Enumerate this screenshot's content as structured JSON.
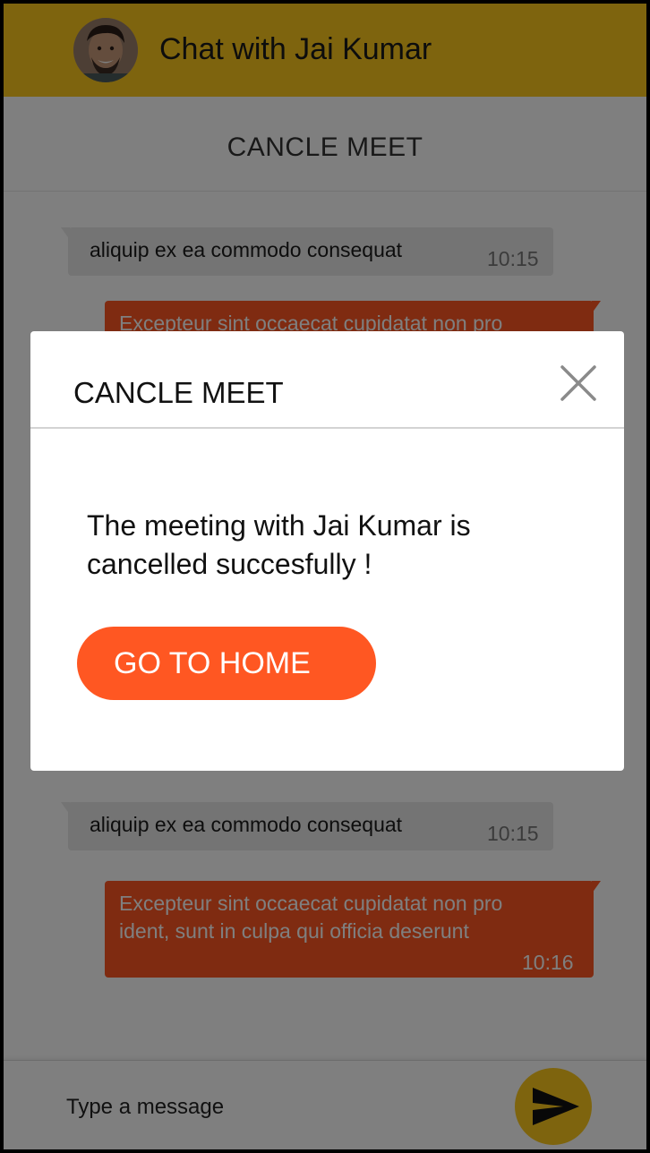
{
  "header": {
    "title": "Chat with Jai Kumar",
    "accent_color": "#FDC81C"
  },
  "subbar": {
    "title": "CANCLE MEET"
  },
  "messages": [
    {
      "direction": "in",
      "text": "aliquip ex ea commodo consequat",
      "time": "10:15"
    },
    {
      "direction": "out",
      "text": "Excepteur sint occaecat cupidatat non pro",
      "time": ""
    },
    {
      "direction": "in",
      "text": "aliquip ex ea commodo consequat",
      "time": "10:15"
    },
    {
      "direction": "out",
      "text": "Excepteur sint occaecat cupidatat non pro\nident, sunt in culpa qui officia deserunt",
      "time": "10:16"
    }
  ],
  "composer": {
    "placeholder": "Type a message"
  },
  "modal": {
    "title": "CANCLE MEET",
    "message": "The meeting with Jai Kumar is cancelled succesfully !",
    "button_label": "GO TO HOME",
    "button_color": "#FF5722"
  },
  "icons": {
    "close": "close-icon",
    "send": "send-icon",
    "avatar": "avatar"
  }
}
